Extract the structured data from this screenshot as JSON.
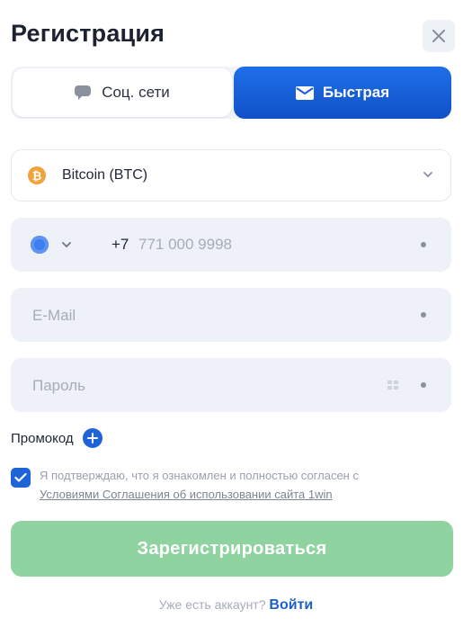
{
  "header": {
    "title": "Регистрация"
  },
  "tabs": {
    "social": {
      "label": "Соц. сети",
      "icon": "chat-bubble-icon"
    },
    "fast": {
      "label": "Быстрая",
      "icon": "envelope-icon",
      "active": true
    }
  },
  "currency": {
    "icon": "bitcoin-icon",
    "selected": "Bitcoin (BTC)"
  },
  "phone": {
    "prefix": "+7",
    "number": "771 000 9998"
  },
  "email": {
    "placeholder": "E-Mail"
  },
  "password": {
    "placeholder": "Пароль"
  },
  "promo": {
    "label": "Промокод"
  },
  "agreement": {
    "checked": true,
    "text": "Я подтверждаю, что я ознакомлен и полностью согласен с",
    "link_text": "Условиями Соглашения об использовании сайта 1win"
  },
  "submit": {
    "label": "Зарегистрироваться"
  },
  "login": {
    "question": "Уже есть аккаунт?",
    "link": "Войти"
  },
  "colors": {
    "accent": "#1f63d8",
    "submit_disabled": "#8ed3a0",
    "field_bg": "#eef1f7",
    "bitcoin": "#f2a23a"
  }
}
